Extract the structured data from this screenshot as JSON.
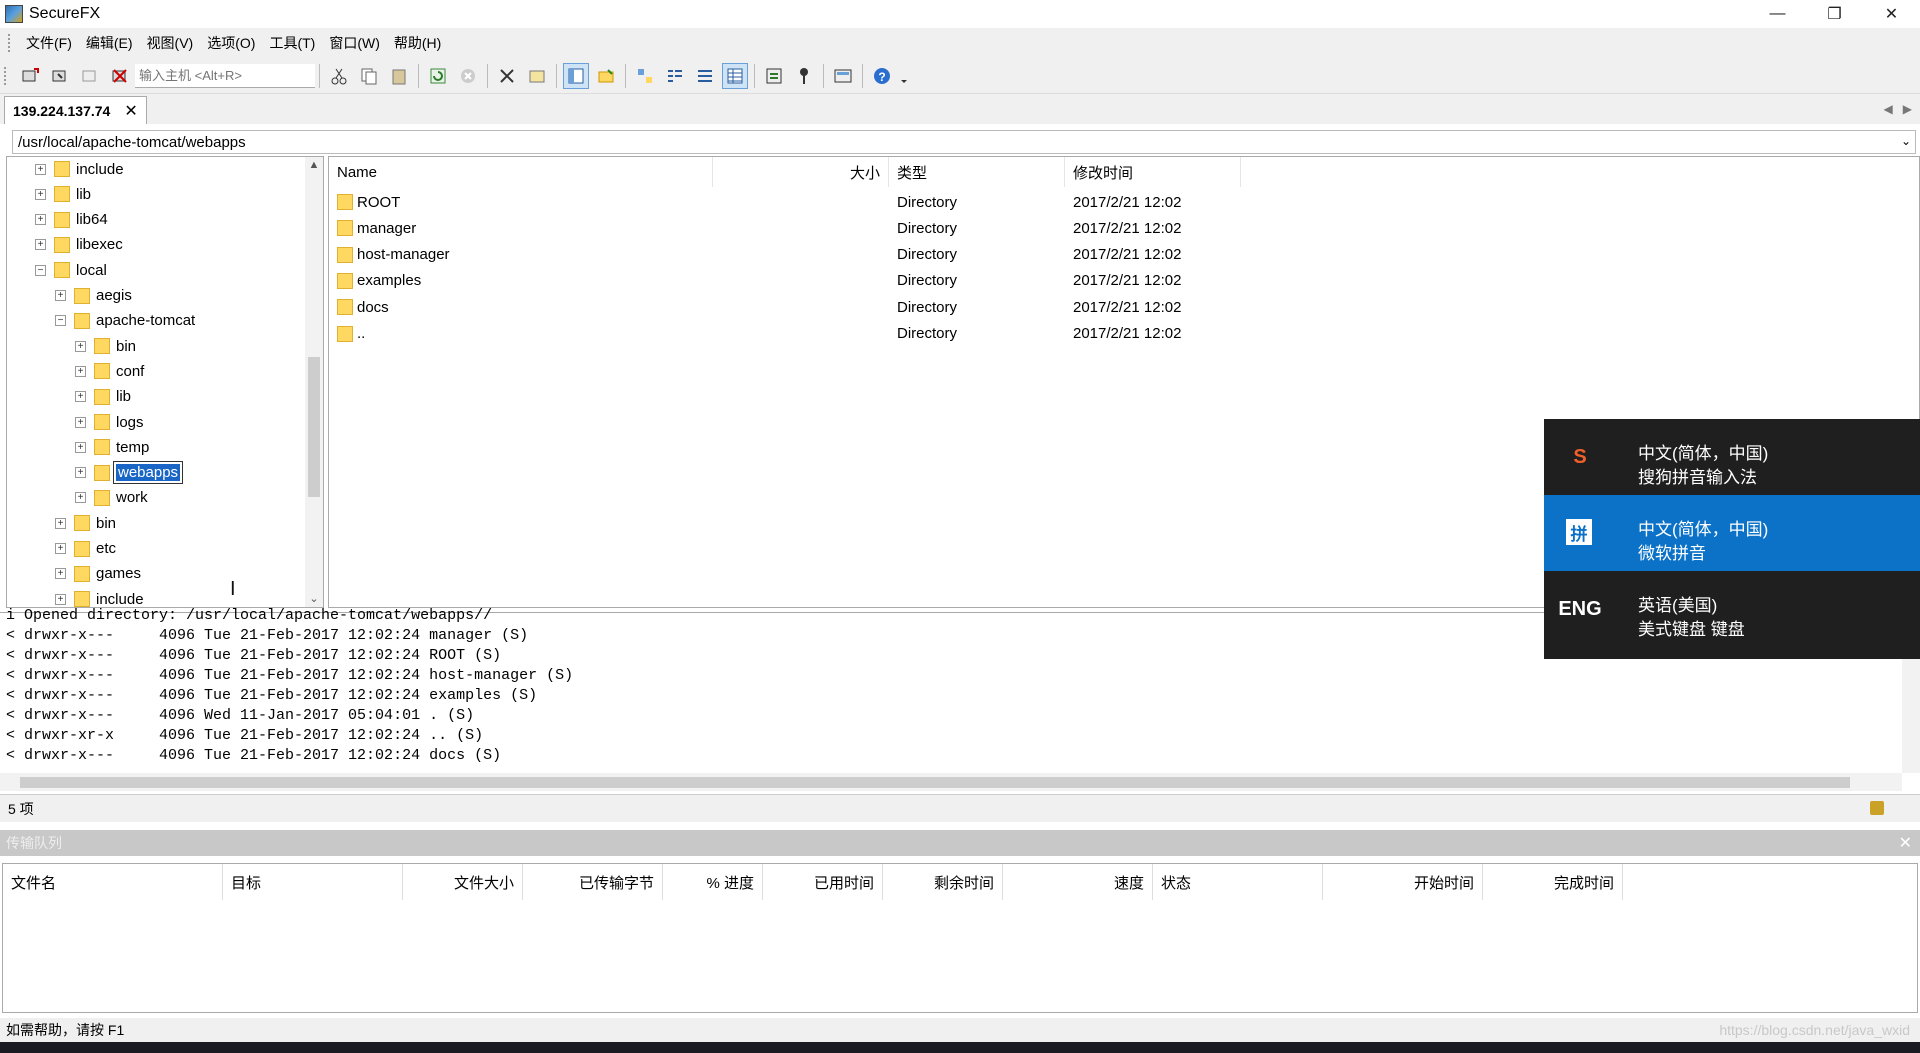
{
  "window": {
    "title": "SecureFX",
    "minimize": "—",
    "restore": "❐",
    "close": "✕"
  },
  "menu": [
    "文件(F)",
    "编辑(E)",
    "视图(V)",
    "选项(O)",
    "工具(T)",
    "窗口(W)",
    "帮助(H)"
  ],
  "toolbar": {
    "host_placeholder": "输入主机 <Alt+R>"
  },
  "session_tab": {
    "label": "139.224.137.74",
    "close": "✕"
  },
  "path": "/usr/local/apache-tomcat/webapps",
  "tree": [
    {
      "label": "include",
      "level": 1,
      "expander": "+"
    },
    {
      "label": "lib",
      "level": 1,
      "expander": "+"
    },
    {
      "label": "lib64",
      "level": 1,
      "expander": "+"
    },
    {
      "label": "libexec",
      "level": 1,
      "expander": "+"
    },
    {
      "label": "local",
      "level": 1,
      "expander": "−"
    },
    {
      "label": "aegis",
      "level": 2,
      "expander": "+"
    },
    {
      "label": "apache-tomcat",
      "level": 2,
      "expander": "−"
    },
    {
      "label": "bin",
      "level": 3,
      "expander": "+"
    },
    {
      "label": "conf",
      "level": 3,
      "expander": "+"
    },
    {
      "label": "lib",
      "level": 3,
      "expander": "+"
    },
    {
      "label": "logs",
      "level": 3,
      "expander": "+"
    },
    {
      "label": "temp",
      "level": 3,
      "expander": "+"
    },
    {
      "label": "webapps",
      "level": 3,
      "expander": "+",
      "selected": true
    },
    {
      "label": "work",
      "level": 3,
      "expander": "+"
    },
    {
      "label": "bin",
      "level": 2,
      "expander": "+"
    },
    {
      "label": "etc",
      "level": 2,
      "expander": "+"
    },
    {
      "label": "games",
      "level": 2,
      "expander": "+"
    },
    {
      "label": "include",
      "level": 2,
      "expander": "+"
    }
  ],
  "file_columns": {
    "name": "Name",
    "size": "大小",
    "type": "类型",
    "modified": "修改时间"
  },
  "files": [
    {
      "name": "ROOT",
      "type": "Directory",
      "modified": "2017/2/21 12:02"
    },
    {
      "name": "manager",
      "type": "Directory",
      "modified": "2017/2/21 12:02"
    },
    {
      "name": "host-manager",
      "type": "Directory",
      "modified": "2017/2/21 12:02"
    },
    {
      "name": "examples",
      "type": "Directory",
      "modified": "2017/2/21 12:02"
    },
    {
      "name": "docs",
      "type": "Directory",
      "modified": "2017/2/21 12:02"
    },
    {
      "name": "..",
      "type": "Directory",
      "modified": "2017/2/21 12:02"
    }
  ],
  "log": [
    "i Opened directory: /usr/local/apache-tomcat/webapps//",
    "< drwxr-x---     4096 Tue 21-Feb-2017 12:02:24 manager (S)",
    "< drwxr-x---     4096 Tue 21-Feb-2017 12:02:24 ROOT (S)",
    "< drwxr-x---     4096 Tue 21-Feb-2017 12:02:24 host-manager (S)",
    "< drwxr-x---     4096 Tue 21-Feb-2017 12:02:24 examples (S)",
    "< drwxr-x---     4096 Wed 11-Jan-2017 05:04:01 . (S)",
    "< drwxr-xr-x     4096 Tue 21-Feb-2017 12:02:24 .. (S)",
    "< drwxr-x---     4096 Tue 21-Feb-2017 12:02:24 docs (S)"
  ],
  "status": {
    "items": "5 项",
    "help": "如需帮助，请按 F1"
  },
  "queue": {
    "title": "传输队列",
    "close": "✕",
    "columns": [
      "文件名",
      "目标",
      "文件大小",
      "已传输字节",
      "% 进度",
      "已用时间",
      "剩余时间",
      "速度",
      "状态",
      "开始时间",
      "完成时间"
    ]
  },
  "ime": [
    {
      "icon": "S",
      "line1": "中文(简体，中国)",
      "line2": "搜狗拼音输入法",
      "active": false
    },
    {
      "icon": "拼",
      "line1": "中文(简体，中国)",
      "line2": "微软拼音",
      "active": true
    },
    {
      "icon": "ENG",
      "line1": "英语(美国)",
      "line2": "美式键盘 键盘",
      "active": false
    }
  ],
  "watermark": "https://blog.csdn.net/java_wxid",
  "colors": {
    "selection": "#1a66c6",
    "ime_active": "#0b72c8",
    "folder": "#ffd862"
  }
}
